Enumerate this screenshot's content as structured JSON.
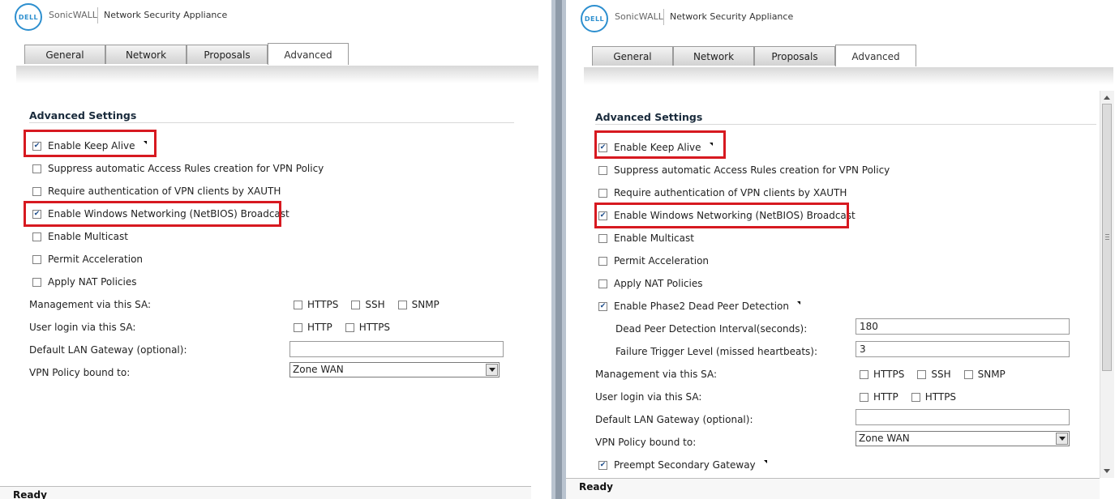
{
  "brand": {
    "logo": "DELL",
    "product": "SonicWALL",
    "app": "Network Security Appliance"
  },
  "tabs": [
    "General",
    "Network",
    "Proposals",
    "Advanced"
  ],
  "active_tab": "Advanced",
  "section_title": "Advanced Settings",
  "checkboxes": {
    "keep_alive": "Enable Keep Alive",
    "suppress": "Suppress automatic Access Rules creation for VPN Policy",
    "xauth": "Require authentication of VPN clients by XAUTH",
    "netbios": "Enable Windows Networking (NetBIOS) Broadcast",
    "multicast": "Enable Multicast",
    "acceleration": "Permit Acceleration",
    "nat": "Apply NAT Policies",
    "phase2_dpd": "Enable Phase2 Dead Peer Detection",
    "preempt": "Preempt Secondary Gateway"
  },
  "fields": {
    "management": "Management via this SA:",
    "user_login": "User login via this SA:",
    "lan_gateway": "Default LAN Gateway (optional):",
    "vpn_bound": "VPN Policy bound to:",
    "dpd_interval": "Dead Peer Detection Interval(seconds):",
    "failure_trigger": "Failure Trigger Level (missed heartbeats):"
  },
  "options": {
    "https": "HTTPS",
    "ssh": "SSH",
    "snmp": "SNMP",
    "http": "HTTP"
  },
  "values": {
    "dpd_interval": "180",
    "failure_trigger": "3",
    "vpn_zone": "Zone WAN",
    "lan_gateway": ""
  },
  "status": "Ready",
  "colors": {
    "highlight": "#d71920",
    "logo": "#2d8fcf"
  }
}
